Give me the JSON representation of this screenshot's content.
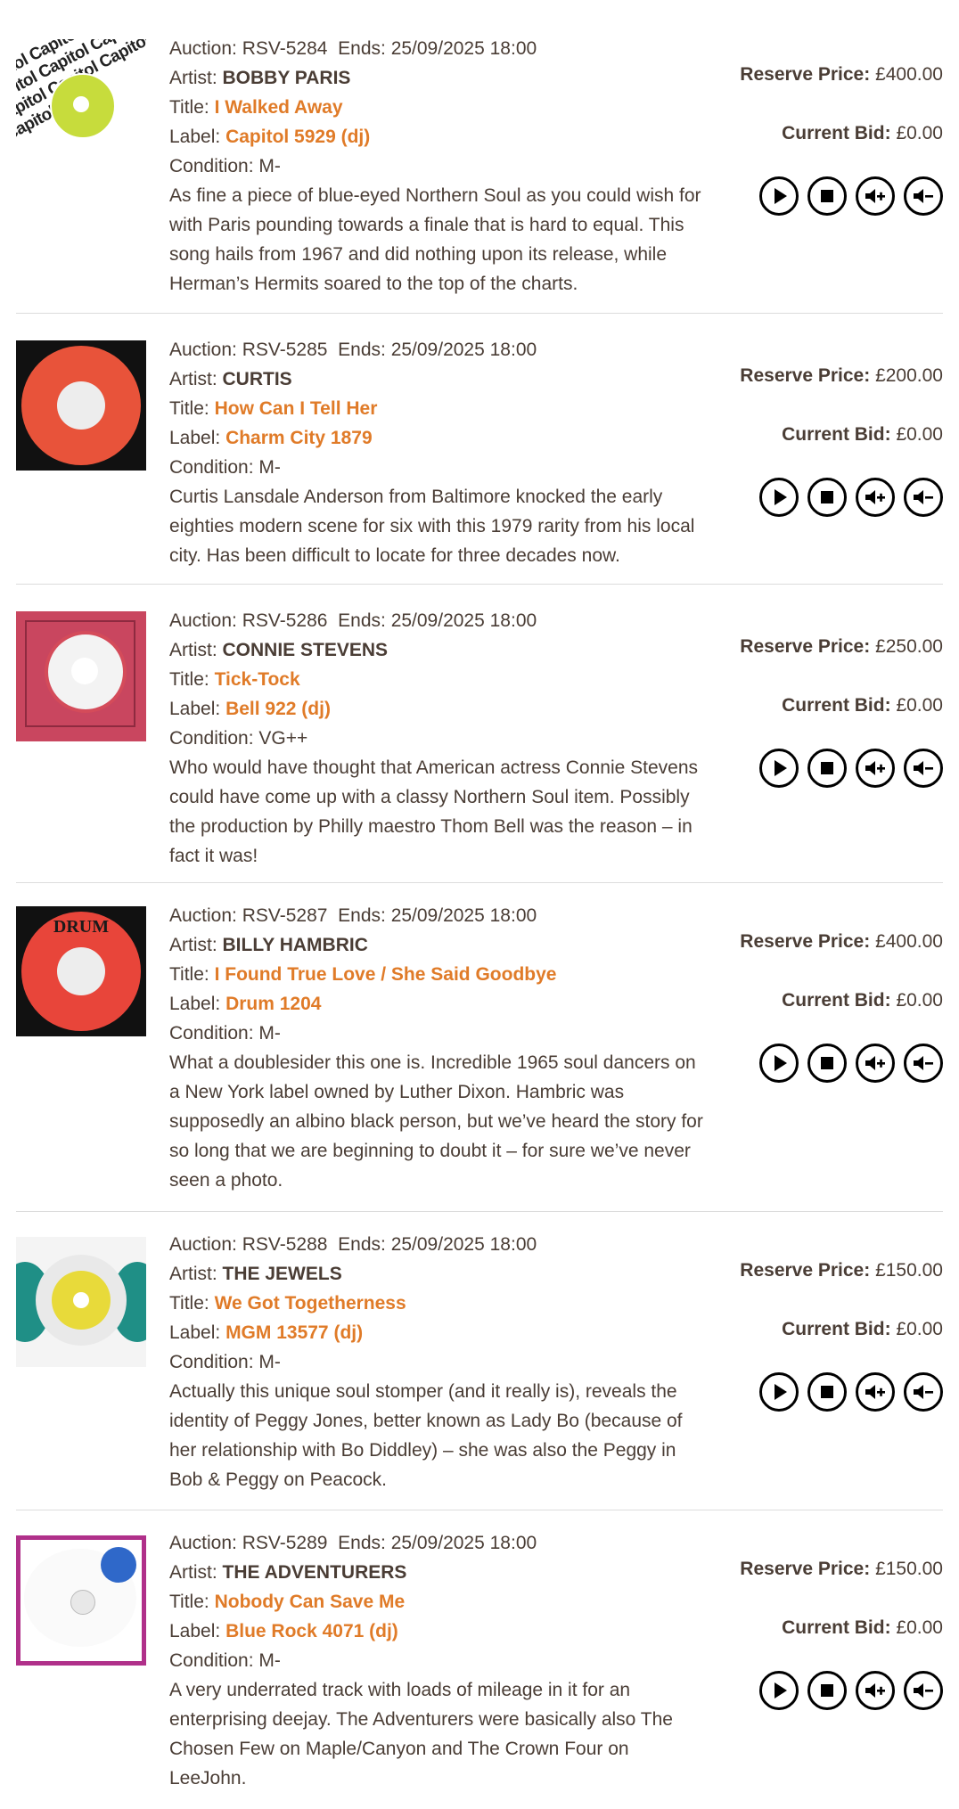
{
  "labels": {
    "auction": "Auction:",
    "ends": "Ends:",
    "artist": "Artist:",
    "title": "Title:",
    "label": "Label:",
    "condition": "Condition:",
    "reserve": "Reserve Price:",
    "current_bid": "Current Bid:"
  },
  "colors": {
    "accent": "#e07b28",
    "text": "#4a3d35",
    "divider": "#dcdcdc"
  },
  "items": [
    {
      "auction": "RSV-5284",
      "ends": "25/09/2025 18:00",
      "artist": "BOBBY PARIS",
      "title": "I Walked Away",
      "label": "Capitol 5929 (dj)",
      "condition": "M-",
      "description": "As fine a piece of blue-eyed Northern Soul as you could wish for with Paris pounding towards a finale that is hard to equal. This song hails from 1967 and did nothing upon its release, while Herman’s Hermits soared to the top of the charts.",
      "reserve": "£400.00",
      "current_bid": "£0.00",
      "sleeve_text": "Capitol Capitol Capitol Capitol Capitol Capitol Capitol Capitol Capitol Capitol"
    },
    {
      "auction": "RSV-5285",
      "ends": "25/09/2025 18:00",
      "artist": "CURTIS",
      "title": "How Can I Tell Her",
      "label": "Charm City 1879",
      "condition": "M-",
      "description": "Curtis Lansdale Anderson from Baltimore knocked the early eighties modern scene for six with this 1979 rarity from his local city. Has been difficult to locate for three decades now.",
      "reserve": "£200.00",
      "current_bid": "£0.00"
    },
    {
      "auction": "RSV-5286",
      "ends": "25/09/2025 18:00",
      "artist": "CONNIE STEVENS",
      "title": "Tick-Tock",
      "label": "Bell 922 (dj)",
      "condition": "VG++",
      "description": "Who would have thought that American actress Connie Stevens could have come up with a classy Northern Soul item. Possibly the production by Philly maestro Thom Bell was the reason – in fact it was!",
      "reserve": "£250.00",
      "current_bid": "£0.00"
    },
    {
      "auction": "RSV-5287",
      "ends": "25/09/2025 18:00",
      "artist": "BILLY HAMBRIC",
      "title": "I Found True Love / She Said Goodbye",
      "label": "Drum 1204",
      "condition": "M-",
      "description": "What a doublesider this one is. Incredible 1965 soul dancers on a New York label owned by Luther Dixon. Hambric was supposedly an albino black person, but we’ve heard the story for so long that we are beginning to doubt it – for sure we’ve never seen a photo.",
      "reserve": "£400.00",
      "current_bid": "£0.00",
      "record_label_text": "DRUM"
    },
    {
      "auction": "RSV-5288",
      "ends": "25/09/2025 18:00",
      "artist": "THE JEWELS",
      "title": "We Got Togetherness",
      "label": "MGM 13577 (dj)",
      "condition": "M-",
      "description": "Actually this unique soul stomper (and it really is), reveals the identity of Peggy Jones, better known as Lady Bo (because of her relationship with Bo Diddley) – she was also the Peggy in Bob & Peggy on Peacock.",
      "reserve": "£150.00",
      "current_bid": "£0.00"
    },
    {
      "auction": "RSV-5289",
      "ends": "25/09/2025 18:00",
      "artist": "THE ADVENTURERS",
      "title": "Nobody Can Save Me",
      "label": "Blue Rock 4071 (dj)",
      "condition": "M-",
      "description": "A very underrated track with loads of mileage in it for an enterprising deejay. The Adventurers were basically also The Chosen Few on Maple/Canyon and The Crown Four on LeeJohn.",
      "reserve": "£150.00",
      "current_bid": "£0.00"
    }
  ]
}
